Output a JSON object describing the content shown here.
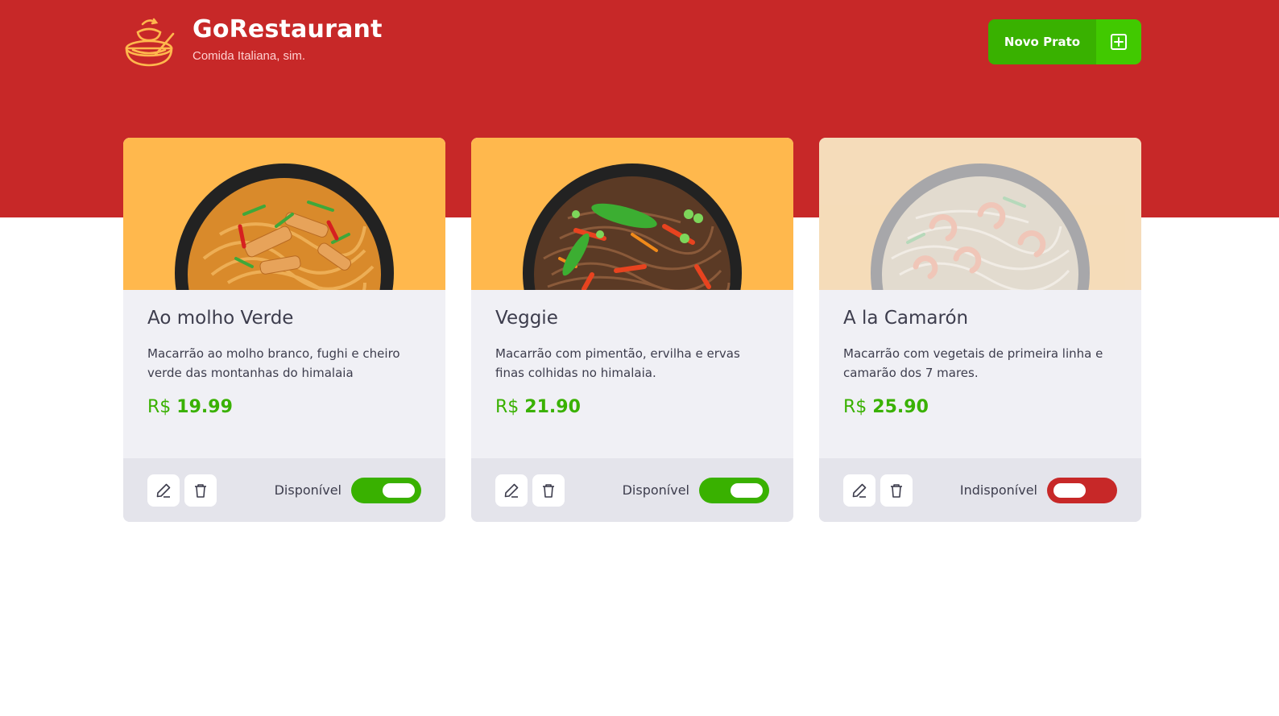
{
  "header": {
    "title": "GoRestaurant",
    "subtitle": "Comida Italiana, sim.",
    "new_button_label": "Novo Prato",
    "colors": {
      "background": "#c72828",
      "button": "#39b100",
      "button_icon": "#41c900"
    }
  },
  "dishes": [
    {
      "name": "Ao molho Verde",
      "description": "Macarrão ao molho branco, fughi e cheiro verde das montanhas do himalaia",
      "currency": "R$",
      "price": "19.99",
      "status_label": "Disponível",
      "available": true,
      "image_icon": "noodle-bowl-chicken"
    },
    {
      "name": "Veggie",
      "description": "Macarrão com pimentão, ervilha e ervas finas colhidas no himalaia.",
      "currency": "R$",
      "price": "21.90",
      "status_label": "Disponível",
      "available": true,
      "image_icon": "noodle-bowl-vegetables"
    },
    {
      "name": "A la Camarón",
      "description": "Macarrão com vegetais de primeira linha e camarão dos 7 mares.",
      "currency": "R$",
      "price": "25.90",
      "status_label": "Indisponível",
      "available": false,
      "image_icon": "noodle-bowl-shrimp"
    }
  ],
  "colors": {
    "image_bg": "#ffb84d",
    "price": "#39b100",
    "toggle_on": "#39b100",
    "toggle_off": "#c72828"
  }
}
